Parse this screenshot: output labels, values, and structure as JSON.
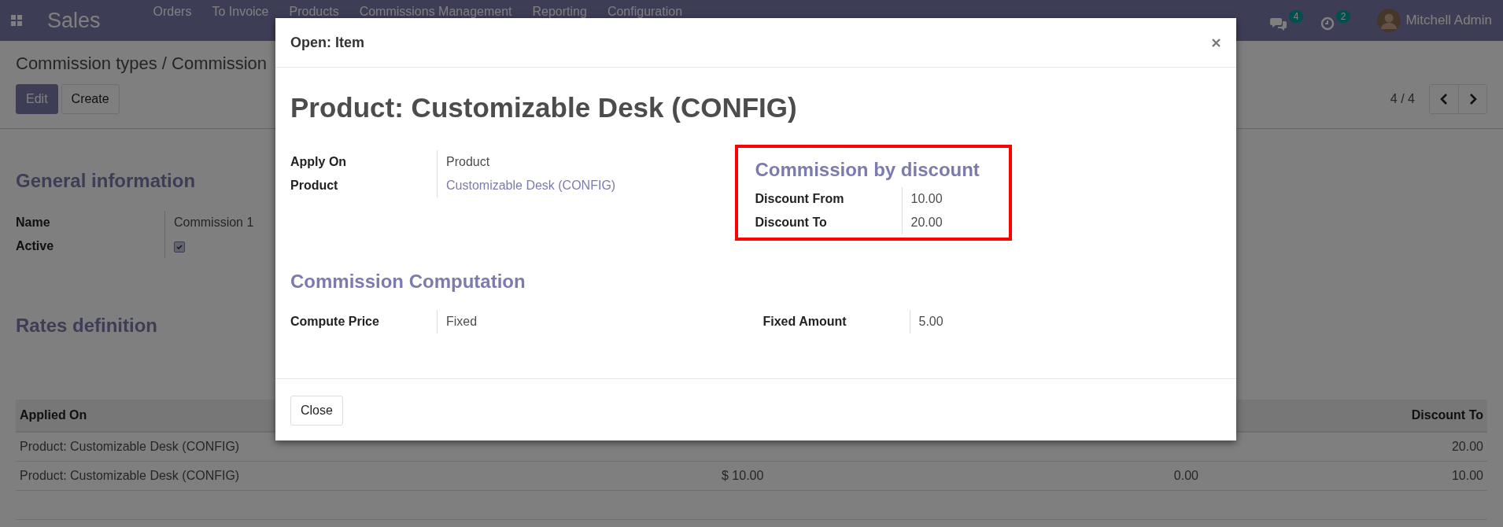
{
  "navbar": {
    "app_name": "Sales",
    "menu": [
      "Orders",
      "To Invoice",
      "Products",
      "Commissions Management",
      "Reporting",
      "Configuration"
    ],
    "messages_count": "4",
    "activities_count": "2",
    "user": "Mitchell Admin"
  },
  "breadcrumb": "Commission types / Commission",
  "buttons": [
    "Edit",
    "Create"
  ],
  "pager": "4 / 4",
  "general": {
    "title": "General information",
    "fields": [
      {
        "label": "Name",
        "kind": "text",
        "value": "Commission 1"
      },
      {
        "label": "Active",
        "kind": "checkbox",
        "checked": true
      }
    ]
  },
  "rates": {
    "title": "Rates definition",
    "header_first": "Applied On",
    "header_last": "Discount To",
    "rows": [
      {
        "applied_on": "Product: Customizable Desk (CONFIG)",
        "discount_to": "20.00"
      },
      {
        "applied_on": "Product: Customizable Desk (CONFIG)",
        "column_2": "$ 10.00",
        "column_3": "0.00",
        "discount_to": "10.00"
      }
    ]
  },
  "modal": {
    "title": "Open: Item",
    "heading": "Product: Customizable Desk (CONFIG)",
    "fields": [
      {
        "label": "Apply On",
        "kind": "text",
        "value": "Product"
      },
      {
        "label": "Product",
        "kind": "link",
        "value": "Customizable Desk (CONFIG)"
      }
    ],
    "discount_group": {
      "title": "Commission by discount",
      "fields": [
        {
          "label": "Discount From",
          "value": "10.00"
        },
        {
          "label": "Discount To",
          "value": "20.00"
        }
      ]
    },
    "computation": {
      "title": "Commission Computation",
      "left": {
        "label": "Compute Price",
        "value": "Fixed"
      },
      "right": {
        "label": "Fixed Amount",
        "value": "5.00"
      }
    },
    "close_button": "Close"
  }
}
